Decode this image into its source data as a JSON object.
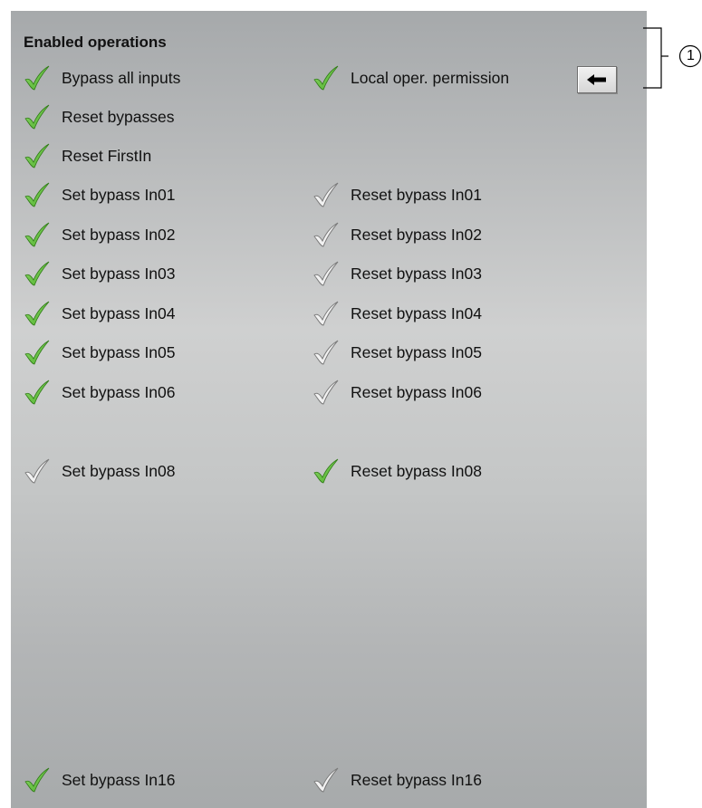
{
  "section_title": "Enabled operations",
  "callout_number": "1",
  "colors": {
    "enabled_check": "#4caf2a",
    "disabled_check": "#7a7a7a"
  },
  "local_button_icon": "arrow-left-icon",
  "operations": {
    "bypass_all_inputs": {
      "label": "Bypass all inputs",
      "enabled": true
    },
    "local_oper_permission": {
      "label": "Local oper. permission",
      "enabled": true
    },
    "reset_bypasses": {
      "label": "Reset bypasses",
      "enabled": true
    },
    "reset_firstin": {
      "label": "Reset FirstIn",
      "enabled": true
    },
    "set_in01": {
      "label": "Set bypass In01",
      "enabled": true
    },
    "reset_in01": {
      "label": "Reset bypass In01",
      "enabled": false
    },
    "set_in02": {
      "label": "Set bypass In02",
      "enabled": true
    },
    "reset_in02": {
      "label": "Reset bypass In02",
      "enabled": false
    },
    "set_in03": {
      "label": "Set bypass In03",
      "enabled": true
    },
    "reset_in03": {
      "label": "Reset bypass In03",
      "enabled": false
    },
    "set_in04": {
      "label": "Set bypass In04",
      "enabled": true
    },
    "reset_in04": {
      "label": "Reset bypass In04",
      "enabled": false
    },
    "set_in05": {
      "label": "Set bypass In05",
      "enabled": true
    },
    "reset_in05": {
      "label": "Reset bypass In05",
      "enabled": false
    },
    "set_in06": {
      "label": "Set bypass In06",
      "enabled": true
    },
    "reset_in06": {
      "label": "Reset bypass In06",
      "enabled": false
    },
    "set_in08": {
      "label": "Set bypass In08",
      "enabled": false
    },
    "reset_in08": {
      "label": "Reset bypass In08",
      "enabled": true
    },
    "set_in16": {
      "label": "Set bypass In16",
      "enabled": true
    },
    "reset_in16": {
      "label": "Reset bypass In16",
      "enabled": false
    }
  }
}
